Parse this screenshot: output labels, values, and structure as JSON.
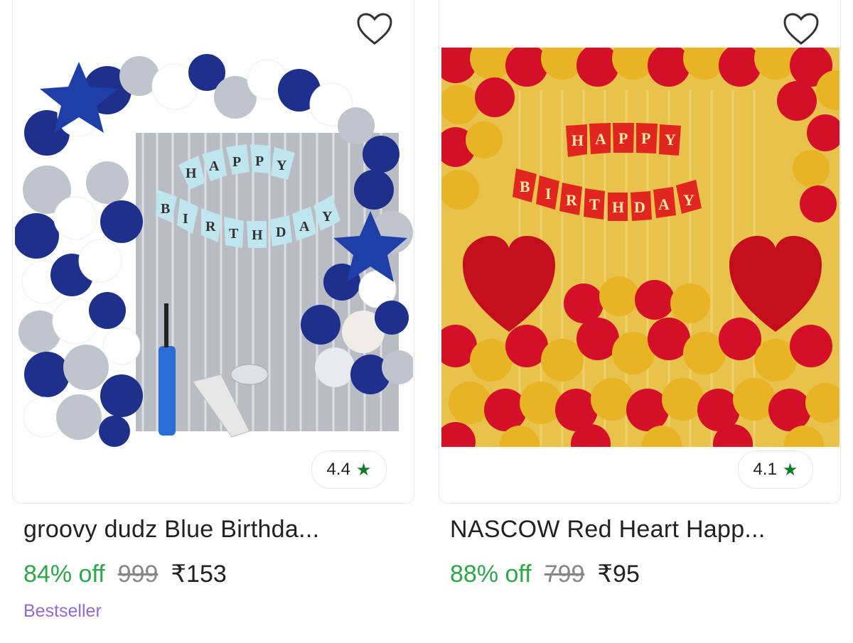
{
  "products": [
    {
      "title": "groovy dudz Blue Birthda...",
      "rating": "4.4",
      "discount": "84% off",
      "mrp": "999",
      "price": "₹153",
      "tag": "Bestseller",
      "image_label": [
        "H",
        "A",
        "P",
        "P",
        "Y",
        "B",
        "I",
        "R",
        "T",
        "H",
        "D",
        "A",
        "Y"
      ],
      "theme_colors": {
        "primary": "#1e2f8c",
        "secondary": "#c0c4cc",
        "banner": "#bfe6ef"
      }
    },
    {
      "title": "NASCOW Red Heart Happ...",
      "rating": "4.1",
      "discount": "88% off",
      "mrp": "799",
      "price": "₹95",
      "tag": "",
      "image_label": [
        "H",
        "A",
        "P",
        "P",
        "Y",
        "B",
        "I",
        "R",
        "T",
        "H",
        "D",
        "A",
        "Y"
      ],
      "theme_colors": {
        "primary": "#d31027",
        "secondary": "#e8b325",
        "banner": "#e0261f"
      }
    }
  ],
  "icons": {
    "wishlist": "heart-outline-icon",
    "rating": "star-icon"
  },
  "colors": {
    "discount": "#2ea64a",
    "tag": "#8f6bdc",
    "star": "#0f7b24"
  }
}
